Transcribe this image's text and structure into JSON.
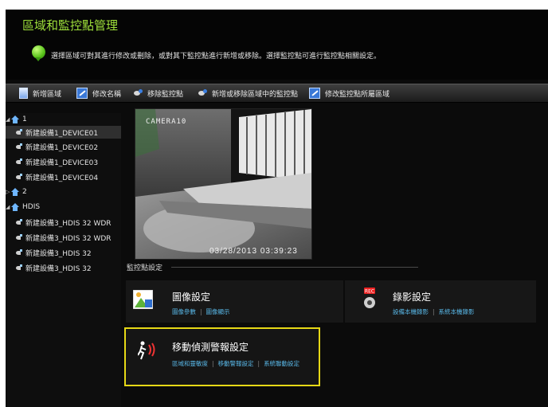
{
  "header": {
    "title": "區域和監控點管理",
    "info_text": "選擇區域可對其進行修改或刪除，或對其下監控點進行新增或移除。選擇監控點可進行監控點相關設定。"
  },
  "toolbar": {
    "add_area": "新增區域",
    "rename": "修改名稱",
    "remove_camera": "移除監控點",
    "add_remove_camera": "新增或移除區域中的監控點",
    "modify_area": "修改監控點所屬區域"
  },
  "tree": {
    "area1": "1",
    "area1_devices": [
      "新建設備1_DEVICE01",
      "新建設備1_DEVICE02",
      "新建設備1_DEVICE03",
      "新建設備1_DEVICE04"
    ],
    "area2": "2",
    "area3": "HDIS",
    "area3_devices": [
      "新建設備3_HDIS 32 WDR",
      "新建設備3_HDIS 32 WDR",
      "新建設備3_HDIS 32",
      "新建設備3_HDIS  32"
    ]
  },
  "camera": {
    "label": "CAMERA10",
    "timestamp": "03/28/2013 03:39:23"
  },
  "settings": {
    "section_label": "監控點設定",
    "image": {
      "title": "圖像設定",
      "link1": "圖像參數",
      "link2": "圖像顯示"
    },
    "record": {
      "title": "錄影設定",
      "link1": "設備本機錄影",
      "link2": "系統本機錄影"
    },
    "motion": {
      "title": "移動偵測警報設定",
      "link1": "區域和靈敏度",
      "link2": "移動警報設定",
      "link3": "系統聯動設定"
    }
  },
  "colors": {
    "title_green": "#9ee03a",
    "link_blue": "#59b8e8",
    "highlight_yellow": "#e6d816",
    "background": "#0b0b0b"
  }
}
